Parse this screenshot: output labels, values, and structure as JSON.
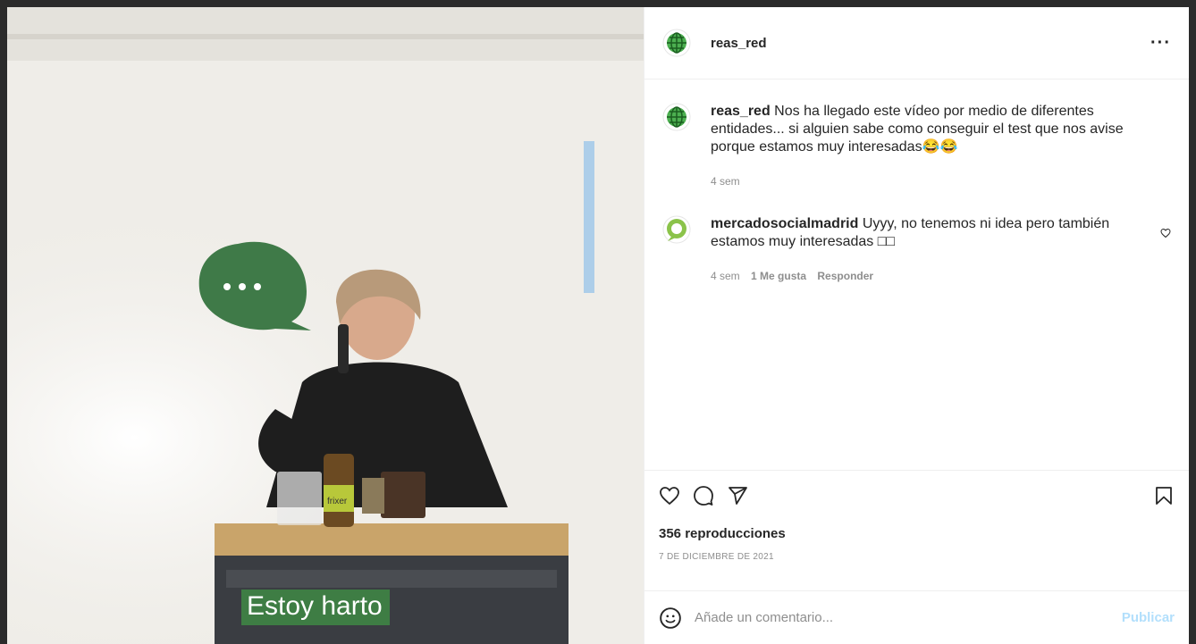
{
  "post": {
    "author": "reas_red",
    "more_label": "···",
    "caption": {
      "username": "reas_red",
      "text": "Nos ha llegado este vídeo por medio de diferentes entidades... si alguien sabe como conseguir el test que nos avise porque estamos muy interesadas😂😂",
      "time": "4 sem"
    },
    "comments": [
      {
        "username": "mercadosocialmadrid",
        "text": "Uyyy, no tenemos ni idea pero también estamos muy interesadas □□",
        "time": "4 sem",
        "likes": "1 Me gusta",
        "reply": "Responder"
      }
    ],
    "views": "356 reproducciones",
    "date": "7 DE DICIEMBRE DE 2021",
    "add_comment_placeholder": "Añade un comentario...",
    "publish_label": "Publicar"
  },
  "video": {
    "subtitle": "Estoy harto",
    "bottle_label": "frixer"
  },
  "colors": {
    "accent_green": "#3e7d44",
    "publish_blue": "#b2dffc"
  }
}
